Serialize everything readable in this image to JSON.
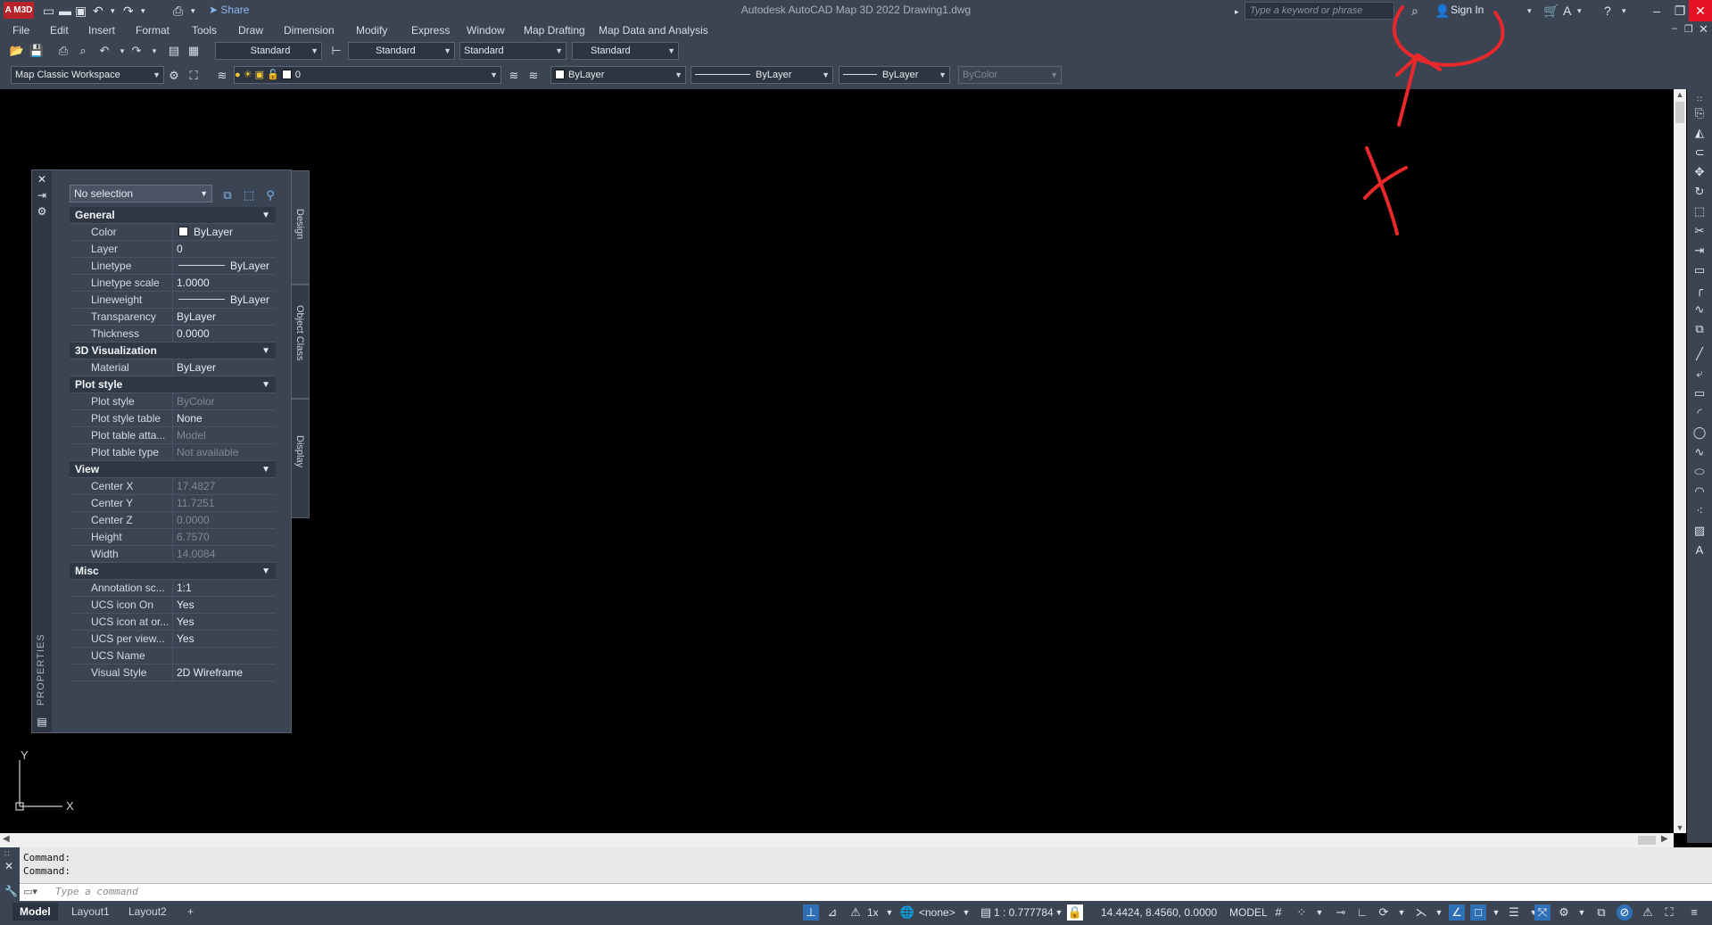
{
  "titlebar": {
    "logo": "A M3D",
    "title": "Autodesk AutoCAD Map 3D 2022   Drawing1.dwg",
    "share": "Share",
    "search_placeholder": "Type a keyword or phrase",
    "signin": "Sign In"
  },
  "menu": [
    "File",
    "Edit",
    "Insert",
    "Format",
    "Tools",
    "Draw",
    "Dimension",
    "Modify",
    "Express",
    "Window",
    "Map Drafting",
    "Map Data and Analysis"
  ],
  "toolbar1": {
    "text_style": "Standard",
    "dim_style": "Standard",
    "table_style": "Standard",
    "mleader_style": "Standard"
  },
  "toolbar2": {
    "workspace": "Map Classic Workspace",
    "layer": "0",
    "color": "ByLayer",
    "linetype": "ByLayer",
    "lineweight": "ByLayer",
    "plotstyle": "ByColor"
  },
  "properties": {
    "selection": "No selection",
    "palette_label": "PROPERTIES",
    "tabs": [
      "Design",
      "Object Class",
      "Display"
    ],
    "categories": {
      "general": "General",
      "viz3d": "3D Visualization",
      "plotstyle": "Plot style",
      "view": "View",
      "misc": "Misc"
    },
    "general": [
      {
        "k": "Color",
        "v": "ByLayer"
      },
      {
        "k": "Layer",
        "v": "0"
      },
      {
        "k": "Linetype",
        "v": "ByLayer"
      },
      {
        "k": "Linetype scale",
        "v": "1.0000"
      },
      {
        "k": "Lineweight",
        "v": "ByLayer"
      },
      {
        "k": "Transparency",
        "v": "ByLayer"
      },
      {
        "k": "Thickness",
        "v": "0.0000"
      }
    ],
    "viz3d": [
      {
        "k": "Material",
        "v": "ByLayer"
      }
    ],
    "plotstyle": [
      {
        "k": "Plot style",
        "v": "ByColor"
      },
      {
        "k": "Plot style table",
        "v": "None"
      },
      {
        "k": "Plot table atta...",
        "v": "Model"
      },
      {
        "k": "Plot table type",
        "v": "Not available"
      }
    ],
    "view": [
      {
        "k": "Center X",
        "v": "17.4827"
      },
      {
        "k": "Center Y",
        "v": "11.7251"
      },
      {
        "k": "Center Z",
        "v": "0.0000"
      },
      {
        "k": "Height",
        "v": "6.7570"
      },
      {
        "k": "Width",
        "v": "14.0084"
      }
    ],
    "misc": [
      {
        "k": "Annotation sc...",
        "v": "1:1"
      },
      {
        "k": "UCS icon On",
        "v": "Yes"
      },
      {
        "k": "UCS icon at or...",
        "v": "Yes"
      },
      {
        "k": "UCS per view...",
        "v": "Yes"
      },
      {
        "k": "UCS Name",
        "v": ""
      },
      {
        "k": "Visual Style",
        "v": "2D Wireframe"
      }
    ]
  },
  "ucs": {
    "x": "X",
    "y": "Y"
  },
  "command": {
    "history": [
      "Command:",
      "Command:"
    ],
    "placeholder": "Type a command"
  },
  "layouts": [
    "Model",
    "Layout1",
    "Layout2"
  ],
  "status": {
    "scale": "1x",
    "coordsys": "<none>",
    "viewscale": "1 : 0.777784",
    "coords": "14.4424, 8.4560, 0.0000",
    "space": "MODEL"
  },
  "colors": {
    "chrome": "#3b4453",
    "canvas": "#000000",
    "accent": "#2f6fb5",
    "close": "#e81123",
    "annotation": "#e8282b"
  }
}
